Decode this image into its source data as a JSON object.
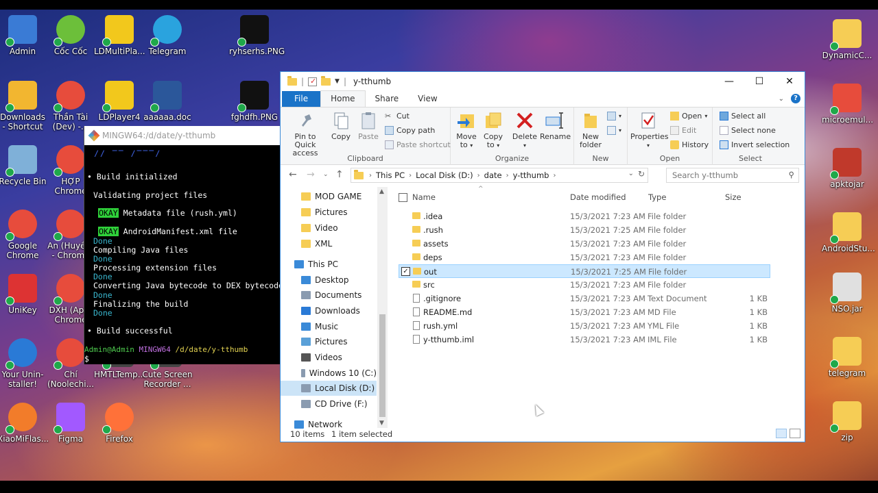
{
  "desktop": {
    "icons_left": [
      {
        "label": "Admin",
        "color": "#3a7bd5"
      },
      {
        "label": "Cốc Cốc",
        "color": "#6cbf3a"
      },
      {
        "label": "LDMultiPla...",
        "color": "#f2c81c"
      },
      {
        "label": "Telegram",
        "color": "#2aa3de"
      },
      {
        "label": "ryhserhs.PNG",
        "color": "#111111"
      },
      {
        "label": "Downloads - Shortcut",
        "color": "#f2b630"
      },
      {
        "label": "Thần Tài (Dev) -...",
        "color": "#e74c3c"
      },
      {
        "label": "LDPlayer4",
        "color": "#f2c81c"
      },
      {
        "label": "aaaaaa.doc",
        "color": "#2b579a"
      },
      {
        "label": "fghdfh.PNG",
        "color": "#111111"
      },
      {
        "label": "Recycle Bin",
        "color": "#7fb0d8"
      },
      {
        "label": "HỢP Chrome",
        "color": "#e74c3c"
      },
      {
        "label": "Google Chrome",
        "color": "#e74c3c"
      },
      {
        "label": "An (Huyền) - Chrome",
        "color": "#e74c3c"
      },
      {
        "label": "UniKey",
        "color": "#d33"
      },
      {
        "label": "DXH (App) Chrome",
        "color": "#e74c3c"
      },
      {
        "label": "Your Unin-staller!",
        "color": "#2a7ad6"
      },
      {
        "label": "Chí (Noolechi...",
        "color": "#e74c3c"
      },
      {
        "label": "HMTLTemp...",
        "color": "#444"
      },
      {
        "label": "Cute Screen Recorder ...",
        "color": "#444"
      },
      {
        "label": "XiaoMiFlas...",
        "color": "#f27c2a"
      },
      {
        "label": "Figma",
        "color": "#a259ff"
      },
      {
        "label": "Firefox",
        "color": "#ff7139"
      }
    ],
    "icons_right": [
      {
        "label": "DynamicC...",
        "color": "#f6cd55"
      },
      {
        "label": "microemul...",
        "color": "#e74c3c"
      },
      {
        "label": "apktojar",
        "color": "#c0392b"
      },
      {
        "label": "AndroidStu...",
        "color": "#f6cd55"
      },
      {
        "label": "NSO.jar",
        "color": "#e0e0e0"
      },
      {
        "label": "telegram",
        "color": "#f6cd55"
      },
      {
        "label": "zip",
        "color": "#f6cd55"
      }
    ]
  },
  "terminal": {
    "title": "MINGW64:/d/date/y-tthumb",
    "lines": {
      "build_init": "• Build initialized",
      "validating": "Validating project files",
      "okay1": "OKAY",
      "meta": "Metadata file (rush.yml)",
      "okay2": "OKAY",
      "manifest": "AndroidManifest.xml file",
      "done1": "Done",
      "compiling": "Compiling Java files",
      "done2": "Done",
      "processing": "Processing extension files",
      "done3": "Done",
      "converting": "Converting Java bytecode to DEX bytecode",
      "done4": "Done",
      "finalizing": "Finalizing the build",
      "done5": "Done",
      "success": "• Build successful",
      "prompt_user": "Admin@Admin",
      "prompt_env": "MINGW64",
      "prompt_path": "/d/date/y-tthumb",
      "prompt_sym": "$"
    }
  },
  "explorer": {
    "title": "y-tthumb",
    "tabs": {
      "file": "File",
      "home": "Home",
      "share": "Share",
      "view": "View"
    },
    "ribbon": {
      "pin": "Pin to Quick access",
      "copy": "Copy",
      "paste": "Paste",
      "cut": "Cut",
      "copy_path": "Copy path",
      "paste_shortcut": "Paste shortcut",
      "clipboard": "Clipboard",
      "move_to": "Move to",
      "copy_to": "Copy to",
      "delete": "Delete",
      "rename": "Rename",
      "organize": "Organize",
      "new_folder": "New folder",
      "new": "New",
      "properties": "Properties",
      "open": "Open",
      "edit": "Edit",
      "history": "History",
      "open_group": "Open",
      "select_all": "Select all",
      "select_none": "Select none",
      "invert_selection": "Invert selection",
      "select": "Select"
    },
    "address": {
      "crumbs": [
        "This PC",
        "Local Disk (D:)",
        "date",
        "y-tthumb"
      ],
      "search_placeholder": "Search y-tthumb"
    },
    "nav": [
      {
        "label": "MOD GAME",
        "color": "#f6cd55"
      },
      {
        "label": "Pictures",
        "color": "#f6cd55"
      },
      {
        "label": "Video",
        "color": "#f6cd55"
      },
      {
        "label": "XML",
        "color": "#f6cd55"
      },
      {
        "label": "This PC",
        "color": "#3a8ad8"
      },
      {
        "label": "Desktop",
        "color": "#3a8ad8"
      },
      {
        "label": "Documents",
        "color": "#8a9bb0"
      },
      {
        "label": "Downloads",
        "color": "#2a7ad6"
      },
      {
        "label": "Music",
        "color": "#3a8ad8"
      },
      {
        "label": "Pictures",
        "color": "#5aa0d8"
      },
      {
        "label": "Videos",
        "color": "#555"
      },
      {
        "label": "Windows 10 (C:)",
        "color": "#8a9bb0"
      },
      {
        "label": "Local Disk (D:)",
        "color": "#8a9bb0"
      },
      {
        "label": "CD Drive (F:)",
        "color": "#8a9bb0"
      },
      {
        "label": "Network",
        "color": "#3a8ad8"
      }
    ],
    "columns": {
      "name": "Name",
      "date": "Date modified",
      "type": "Type",
      "size": "Size"
    },
    "files": [
      {
        "name": ".idea",
        "date": "15/3/2021 7:23 AM",
        "type": "File folder",
        "size": "",
        "kind": "folder"
      },
      {
        "name": ".rush",
        "date": "15/3/2021 7:25 AM",
        "type": "File folder",
        "size": "",
        "kind": "folder"
      },
      {
        "name": "assets",
        "date": "15/3/2021 7:23 AM",
        "type": "File folder",
        "size": "",
        "kind": "folder"
      },
      {
        "name": "deps",
        "date": "15/3/2021 7:23 AM",
        "type": "File folder",
        "size": "",
        "kind": "folder"
      },
      {
        "name": "out",
        "date": "15/3/2021 7:25 AM",
        "type": "File folder",
        "size": "",
        "kind": "folder",
        "selected": true
      },
      {
        "name": "src",
        "date": "15/3/2021 7:23 AM",
        "type": "File folder",
        "size": "",
        "kind": "folder"
      },
      {
        "name": ".gitignore",
        "date": "15/3/2021 7:23 AM",
        "type": "Text Document",
        "size": "1 KB",
        "kind": "file"
      },
      {
        "name": "README.md",
        "date": "15/3/2021 7:23 AM",
        "type": "MD File",
        "size": "1 KB",
        "kind": "file"
      },
      {
        "name": "rush.yml",
        "date": "15/3/2021 7:23 AM",
        "type": "YML File",
        "size": "1 KB",
        "kind": "file"
      },
      {
        "name": "y-tthumb.iml",
        "date": "15/3/2021 7:23 AM",
        "type": "IML File",
        "size": "1 KB",
        "kind": "file"
      }
    ],
    "status": {
      "count": "10 items",
      "selected": "1 item selected"
    }
  }
}
